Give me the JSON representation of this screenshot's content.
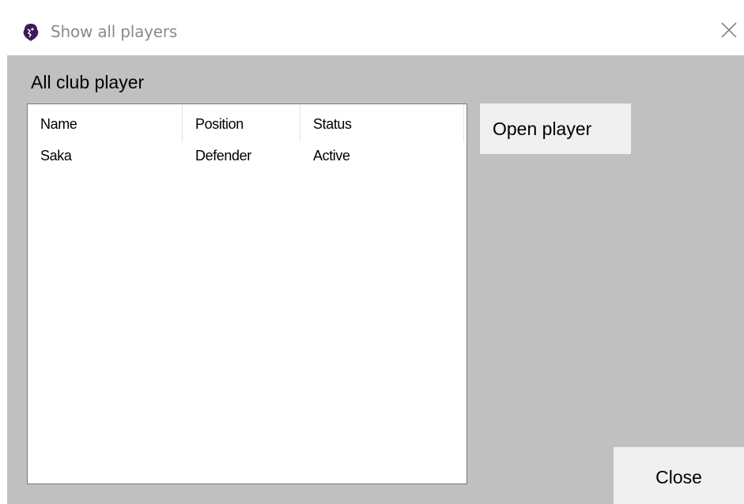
{
  "window": {
    "title": "Show all players",
    "icon": "premier-league-lion-icon",
    "close_glyph": "✕"
  },
  "group": {
    "label": "All club player"
  },
  "players_list": {
    "columns": [
      "Name",
      "Position",
      "Status"
    ],
    "rows": [
      [
        "Saka",
        "Defender",
        "Active"
      ]
    ]
  },
  "buttons": {
    "open_player": "Open player",
    "close": "Close"
  },
  "colors": {
    "client_background": "#c0c0c0",
    "button_face": "#f0f0f0",
    "icon_purple": "#3d195b"
  }
}
